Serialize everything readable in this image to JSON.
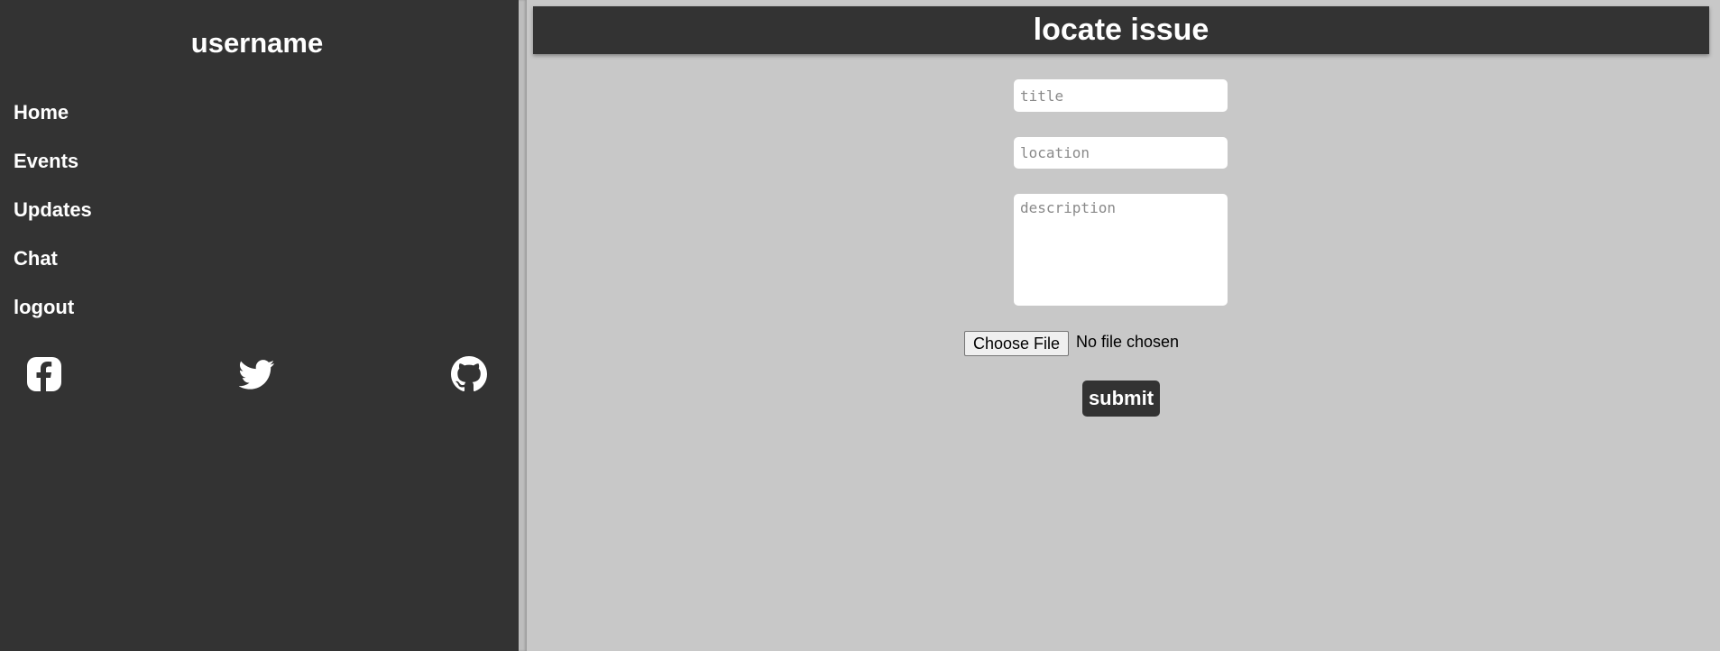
{
  "sidebar": {
    "username": "username",
    "nav_items": [
      {
        "label": "Home"
      },
      {
        "label": "Events"
      },
      {
        "label": "Updates"
      },
      {
        "label": "Chat"
      },
      {
        "label": "logout"
      }
    ],
    "social_icons": [
      "facebook-icon",
      "twitter-icon",
      "github-icon"
    ]
  },
  "header": {
    "title": "locate issue"
  },
  "form": {
    "title_placeholder": "title",
    "location_placeholder": "location",
    "description_placeholder": "description",
    "file_button_label": "Choose File",
    "file_status": "No file chosen",
    "submit_label": "submit"
  },
  "colors": {
    "sidebar_bg": "#333333",
    "content_bg": "#c8c8c8",
    "header_bg": "#333333",
    "text_light": "#ffffff"
  }
}
